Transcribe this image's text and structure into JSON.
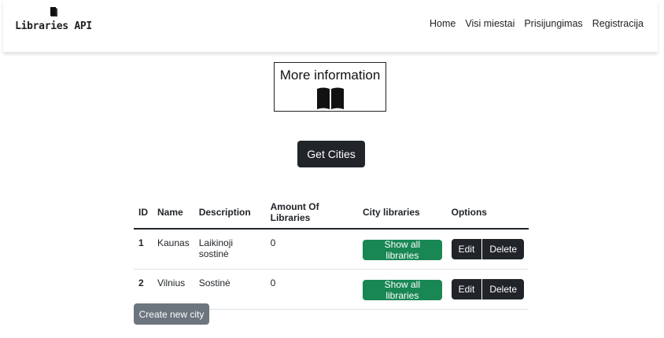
{
  "brand": {
    "name": "Libraries API",
    "icon": "book-icon"
  },
  "nav": [
    "Home",
    "Visi miestai",
    "Prisijungimas",
    "Registracija"
  ],
  "info_box": {
    "title": "More information",
    "icon": "open-book-icon"
  },
  "actions": {
    "get_cities": "Get Cities",
    "create_city": "Create new city"
  },
  "table": {
    "headers": [
      "ID",
      "Name",
      "Description",
      "Amount Of Libraries",
      "City libraries",
      "Options"
    ],
    "rows": [
      {
        "id": "1",
        "name": "Kaunas",
        "description": "Laikinoji sostinė",
        "amount": "0",
        "libraries_button": "Show all libraries",
        "edit": "Edit",
        "delete": "Delete"
      },
      {
        "id": "2",
        "name": "Vilnius",
        "description": "Sostinė",
        "amount": "0",
        "libraries_button": "Show all libraries",
        "edit": "Edit",
        "delete": "Delete"
      }
    ]
  },
  "colors": {
    "dark": "#212529",
    "success": "#198754",
    "secondary": "#6c757d"
  }
}
